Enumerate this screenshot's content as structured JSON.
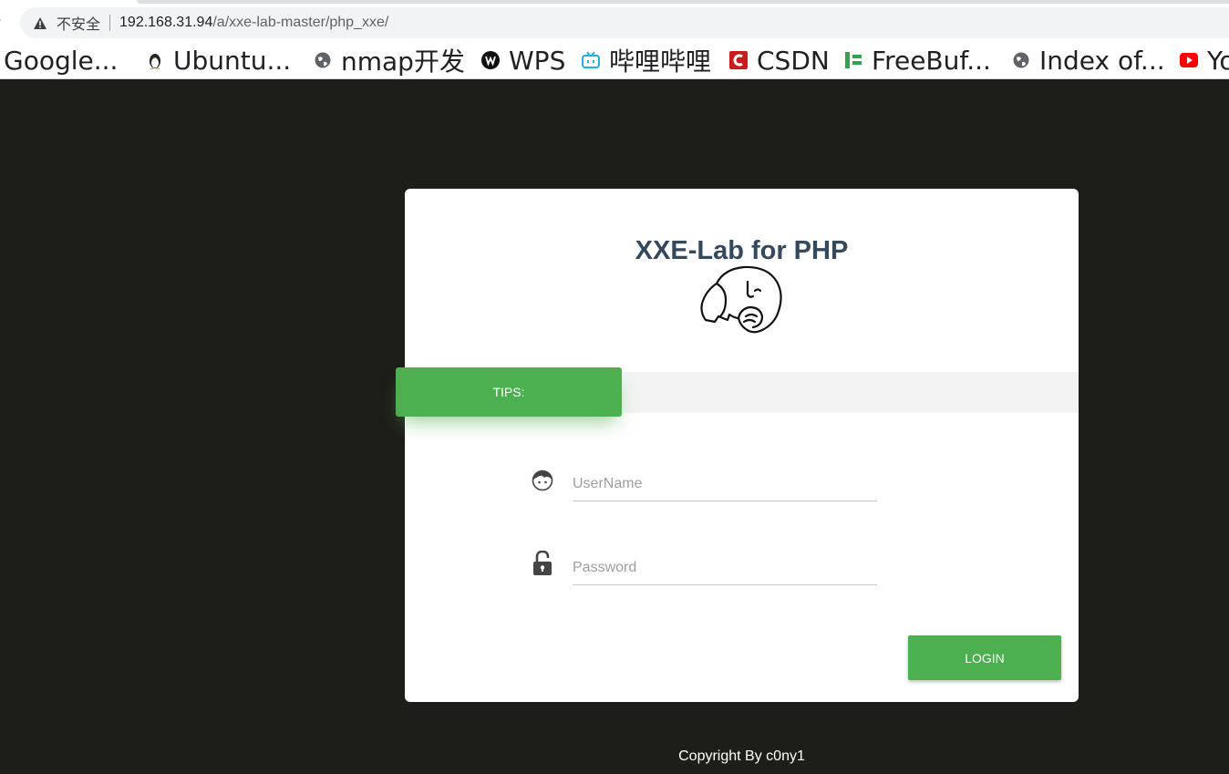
{
  "browser": {
    "security_label": "不安全",
    "url_host": "192.168.31.94",
    "url_path": "/a/xxe-lab-master/php_xxe/"
  },
  "bookmarks": [
    {
      "label": "Google...",
      "icon": "google-icon"
    },
    {
      "label": "Ubuntu...",
      "icon": "tux-icon"
    },
    {
      "label": "nmap开发",
      "icon": "globe-icon"
    },
    {
      "label": "WPS",
      "icon": "wps-icon"
    },
    {
      "label": "哔哩哔哩",
      "icon": "bilibili-icon"
    },
    {
      "label": "CSDN",
      "icon": "csdn-icon"
    },
    {
      "label": "FreeBuf...",
      "icon": "freebuf-icon"
    },
    {
      "label": "Index of...",
      "icon": "globe-icon"
    },
    {
      "label": "Yo",
      "icon": "youtube-icon"
    }
  ],
  "card": {
    "title": "XXE-Lab for PHP",
    "tips_label": "TIPS:",
    "username_placeholder": "UserName",
    "password_placeholder": "Password",
    "login_label": "LOGIN"
  },
  "footer": {
    "copyright": "Copyright By c0ny1"
  },
  "colors": {
    "accent": "#4caf50",
    "page_bg": "#1d1d19",
    "title": "#34495e"
  }
}
